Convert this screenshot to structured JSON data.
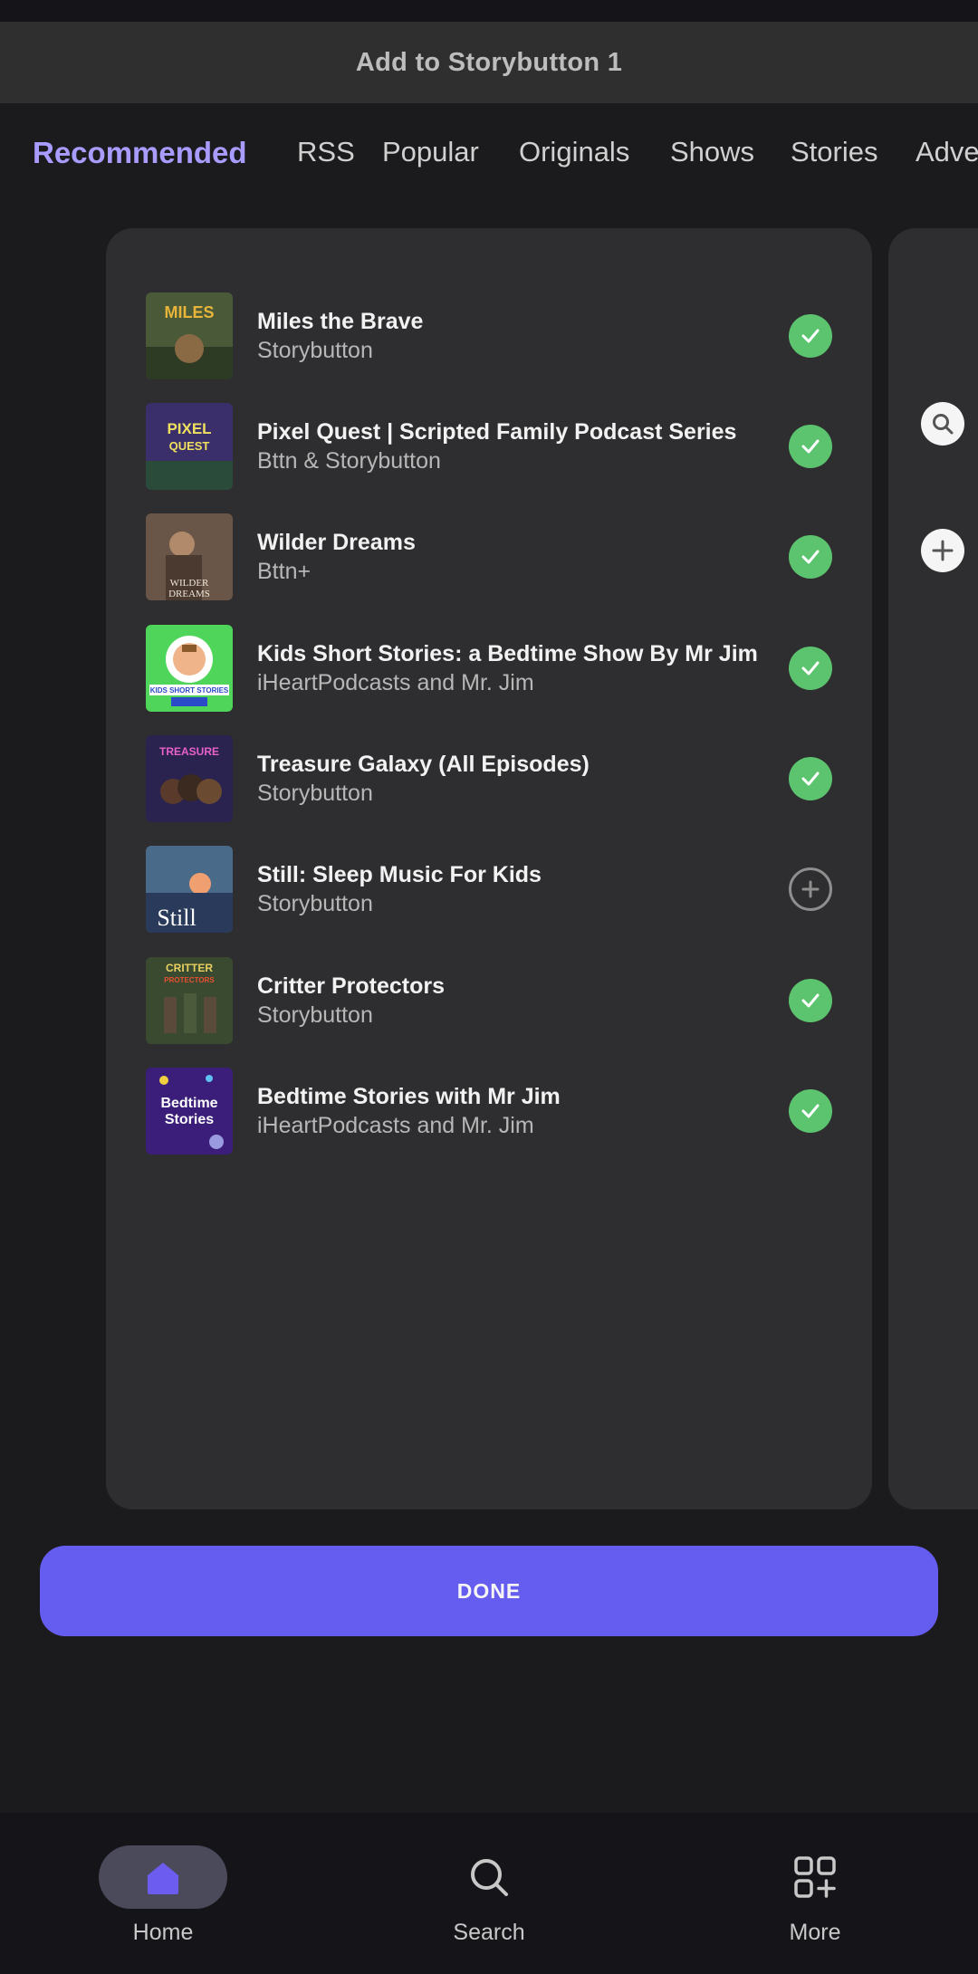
{
  "header": {
    "title": "Add to Storybutton 1"
  },
  "tabs": [
    {
      "label": "Recommended",
      "active": true
    },
    {
      "label": "RSS",
      "active": false
    },
    {
      "label": "Popular",
      "active": false
    },
    {
      "label": "Originals",
      "active": false
    },
    {
      "label": "Shows",
      "active": false
    },
    {
      "label": "Stories",
      "active": false
    },
    {
      "label": "Adve",
      "active": false
    }
  ],
  "shows": [
    {
      "title": "Miles the Brave",
      "publisher": "Storybutton",
      "added": true,
      "art_text": "MILES"
    },
    {
      "title": "Pixel Quest | Scripted Family Podcast Series",
      "publisher": "Bttn & Storybutton",
      "added": true,
      "art_text": "PIXEL QUEST"
    },
    {
      "title": "Wilder Dreams",
      "publisher": "Bttn+",
      "added": true,
      "art_text": "WILDER DREAMS"
    },
    {
      "title": "Kids Short Stories: a Bedtime Show By Mr Jim",
      "publisher": "iHeartPodcasts and Mr. Jim",
      "added": true,
      "art_text": "KIDS SHORT STORIES"
    },
    {
      "title": "Treasure Galaxy (All Episodes)",
      "publisher": "Storybutton",
      "added": true,
      "art_text": "TREASURE GALAXY"
    },
    {
      "title": "Still: Sleep Music For Kids",
      "publisher": "Storybutton",
      "added": false,
      "art_text": "Still"
    },
    {
      "title": "Critter Protectors",
      "publisher": "Storybutton",
      "added": true,
      "art_text": "CRITTER PROTECTORS"
    },
    {
      "title": "Bedtime Stories with Mr Jim",
      "publisher": "iHeartPodcasts and Mr. Jim",
      "added": true,
      "art_text": "Bedtime Stories"
    }
  ],
  "actions": {
    "done_label": "DONE"
  },
  "nav": [
    {
      "label": "Home",
      "icon": "home-icon",
      "active": true
    },
    {
      "label": "Search",
      "icon": "search-icon",
      "active": false
    },
    {
      "label": "More",
      "icon": "more-apps-icon",
      "active": false
    }
  ],
  "colors": {
    "accent": "#655cf0",
    "active_tab": "#a99cff",
    "added": "#5cc46f"
  }
}
